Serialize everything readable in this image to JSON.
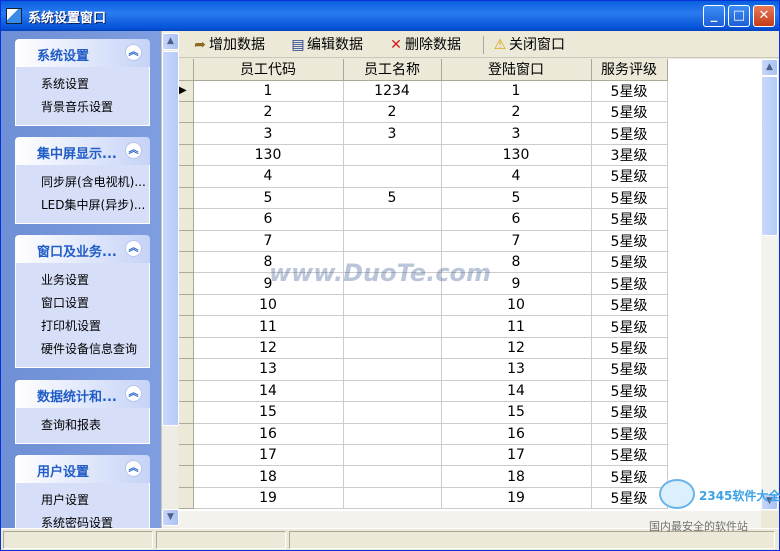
{
  "window": {
    "title": "系统设置窗口",
    "min_label": "_",
    "max_label": "□",
    "close_label": "✕"
  },
  "sidebar": {
    "groups": [
      {
        "title": "系统设置",
        "items": [
          "系统设置",
          "背景音乐设置"
        ]
      },
      {
        "title": "集中屏显示...",
        "items": [
          "同步屏(含电视机)...",
          "LED集中屏(异步)..."
        ]
      },
      {
        "title": "窗口及业务...",
        "items": [
          "业务设置",
          "窗口设置",
          "打印机设置",
          "硬件设备信息查询"
        ]
      },
      {
        "title": "数据统计和...",
        "items": [
          "查询和报表"
        ]
      },
      {
        "title": "用户设置",
        "items": [
          "用户设置",
          "系统密码设置"
        ]
      }
    ]
  },
  "toolbar": {
    "add": "增加数据",
    "edit": "编辑数据",
    "delete": "删除数据",
    "close": "关闭窗口"
  },
  "table": {
    "columns": [
      "员工代码",
      "员工名称",
      "登陆窗口",
      "服务评级"
    ],
    "rows": [
      [
        "1",
        "1234",
        "1",
        "5星级"
      ],
      [
        "2",
        "2",
        "2",
        "5星级"
      ],
      [
        "3",
        "3",
        "3",
        "5星级"
      ],
      [
        "130",
        "",
        "130",
        "3星级"
      ],
      [
        "4",
        "",
        "4",
        "5星级"
      ],
      [
        "5",
        "5",
        "5",
        "5星级"
      ],
      [
        "6",
        "",
        "6",
        "5星级"
      ],
      [
        "7",
        "",
        "7",
        "5星级"
      ],
      [
        "8",
        "",
        "8",
        "5星级"
      ],
      [
        "9",
        "",
        "9",
        "5星级"
      ],
      [
        "10",
        "",
        "10",
        "5星级"
      ],
      [
        "11",
        "",
        "11",
        "5星级"
      ],
      [
        "12",
        "",
        "12",
        "5星级"
      ],
      [
        "13",
        "",
        "13",
        "5星级"
      ],
      [
        "14",
        "",
        "14",
        "5星级"
      ],
      [
        "15",
        "",
        "15",
        "5星级"
      ],
      [
        "16",
        "",
        "16",
        "5星级"
      ],
      [
        "17",
        "",
        "17",
        "5星级"
      ],
      [
        "18",
        "",
        "18",
        "5星级"
      ],
      [
        "19",
        "",
        "19",
        "5星级"
      ]
    ],
    "current_row_marker": "▶"
  },
  "watermark": {
    "center": "www.DuoTe.com",
    "brand": "2345软件大全",
    "slogan": "国内最安全的软件站"
  },
  "colors": {
    "title_bar": "#0A5FDF",
    "sidebar_bg": "#7E9EE0",
    "group_title": "#215DC6"
  }
}
